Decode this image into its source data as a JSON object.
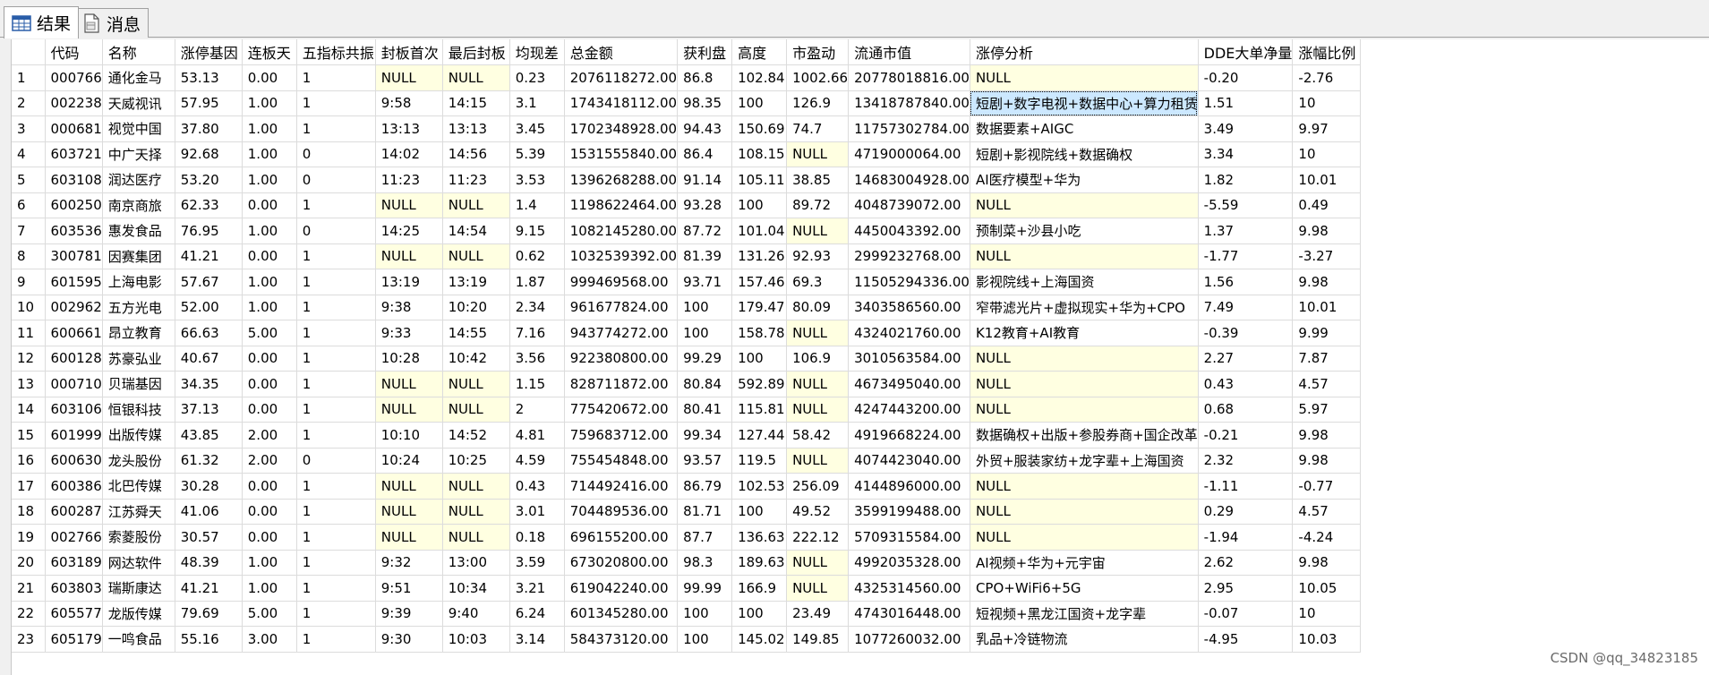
{
  "tabs": [
    {
      "label": "结果",
      "icon": "grid-icon",
      "active": true
    },
    {
      "label": "消息",
      "icon": "message-doc-icon",
      "active": false
    }
  ],
  "grid": {
    "columns": [
      "",
      "代码",
      "名称",
      "涨停基因",
      "连板天",
      "五指标共振",
      "封板首次",
      "最后封板",
      "均现差",
      "总金额",
      "获利盘",
      "高度",
      "市盈动",
      "流通市值",
      "涨停分析",
      "DDE大单净量",
      "涨幅比例"
    ],
    "rows": [
      [
        "1",
        "000766",
        "通化金马",
        "53.13",
        "0.00",
        "1",
        "NULL",
        "NULL",
        "0.23",
        "2076118272.00",
        "86.8",
        "102.84",
        "1002.66",
        "20778018816.00",
        "NULL",
        "-0.20",
        "-2.76"
      ],
      [
        "2",
        "002238",
        "天威视讯",
        "57.95",
        "1.00",
        "1",
        "9:58",
        "14:15",
        "3.1",
        "1743418112.00",
        "98.35",
        "100",
        "126.9",
        "13418787840.00",
        "短剧+数字电视+数据中心+算力租赁",
        "1.51",
        "10"
      ],
      [
        "3",
        "000681",
        "视觉中国",
        "37.80",
        "1.00",
        "1",
        "13:13",
        "13:13",
        "3.45",
        "1702348928.00",
        "94.43",
        "150.69",
        "74.7",
        "11757302784.00",
        "数据要素+AIGC",
        "3.49",
        "9.97"
      ],
      [
        "4",
        "603721",
        "中广天择",
        "92.68",
        "1.00",
        "0",
        "14:02",
        "14:56",
        "5.39",
        "1531555840.00",
        "86.4",
        "108.15",
        "NULL",
        "4719000064.00",
        "短剧+影视院线+数据确权",
        "3.34",
        "10"
      ],
      [
        "5",
        "603108",
        "润达医疗",
        "53.20",
        "1.00",
        "0",
        "11:23",
        "11:23",
        "3.53",
        "1396268288.00",
        "91.14",
        "105.11",
        "38.85",
        "14683004928.00",
        "AI医疗模型+华为",
        "1.82",
        "10.01"
      ],
      [
        "6",
        "600250",
        "南京商旅",
        "62.33",
        "0.00",
        "1",
        "NULL",
        "NULL",
        "1.4",
        "1198622464.00",
        "93.28",
        "100",
        "89.72",
        "4048739072.00",
        "NULL",
        "-5.59",
        "0.49"
      ],
      [
        "7",
        "603536",
        "惠发食品",
        "76.95",
        "1.00",
        "0",
        "14:25",
        "14:54",
        "9.15",
        "1082145280.00",
        "87.72",
        "101.04",
        "NULL",
        "4450043392.00",
        "预制菜+沙县小吃",
        "1.37",
        "9.98"
      ],
      [
        "8",
        "300781",
        "因赛集团",
        "41.21",
        "0.00",
        "1",
        "NULL",
        "NULL",
        "0.62",
        "1032539392.00",
        "81.39",
        "131.26",
        "92.93",
        "2999232768.00",
        "NULL",
        "-1.77",
        "-3.27"
      ],
      [
        "9",
        "601595",
        "上海电影",
        "57.67",
        "1.00",
        "1",
        "13:19",
        "13:19",
        "1.87",
        "999469568.00",
        "93.71",
        "157.46",
        "69.3",
        "11505294336.00",
        "影视院线+上海国资",
        "1.56",
        "9.98"
      ],
      [
        "10",
        "002962",
        "五方光电",
        "52.00",
        "1.00",
        "1",
        "9:38",
        "10:20",
        "2.34",
        "961677824.00",
        "100",
        "179.47",
        "80.09",
        "3403586560.00",
        "窄带滤光片+虚拟现实+华为+CPO",
        "7.49",
        "10.01"
      ],
      [
        "11",
        "600661",
        "昂立教育",
        "66.63",
        "5.00",
        "1",
        "9:33",
        "14:55",
        "7.16",
        "943774272.00",
        "100",
        "158.78",
        "NULL",
        "4324021760.00",
        "K12教育+AI教育",
        "-0.39",
        "9.99"
      ],
      [
        "12",
        "600128",
        "苏豪弘业",
        "40.67",
        "0.00",
        "1",
        "10:28",
        "10:42",
        "3.56",
        "922380800.00",
        "99.29",
        "100",
        "106.9",
        "3010563584.00",
        "NULL",
        "2.27",
        "7.87"
      ],
      [
        "13",
        "000710",
        "贝瑞基因",
        "34.35",
        "0.00",
        "1",
        "NULL",
        "NULL",
        "1.15",
        "828711872.00",
        "80.84",
        "592.89",
        "NULL",
        "4673495040.00",
        "NULL",
        "0.43",
        "4.57"
      ],
      [
        "14",
        "603106",
        "恒银科技",
        "37.13",
        "0.00",
        "1",
        "NULL",
        "NULL",
        "2",
        "775420672.00",
        "80.41",
        "115.81",
        "NULL",
        "4247443200.00",
        "NULL",
        "0.68",
        "5.97"
      ],
      [
        "15",
        "601999",
        "出版传媒",
        "43.85",
        "2.00",
        "1",
        "10:10",
        "14:52",
        "4.81",
        "759683712.00",
        "99.34",
        "127.44",
        "58.42",
        "4919668224.00",
        "数据确权+出版+参股券商+国企改革",
        "-0.21",
        "9.98"
      ],
      [
        "16",
        "600630",
        "龙头股份",
        "61.32",
        "2.00",
        "0",
        "10:24",
        "10:25",
        "4.59",
        "755454848.00",
        "93.57",
        "119.5",
        "NULL",
        "4074423040.00",
        "外贸+服装家纺+龙字辈+上海国资",
        "2.32",
        "9.98"
      ],
      [
        "17",
        "600386",
        "北巴传媒",
        "30.28",
        "0.00",
        "1",
        "NULL",
        "NULL",
        "0.43",
        "714492416.00",
        "86.79",
        "102.53",
        "256.09",
        "4144896000.00",
        "NULL",
        "-1.11",
        "-0.77"
      ],
      [
        "18",
        "600287",
        "江苏舜天",
        "41.06",
        "0.00",
        "1",
        "NULL",
        "NULL",
        "3.01",
        "704489536.00",
        "81.71",
        "100",
        "49.52",
        "3599199488.00",
        "NULL",
        "0.29",
        "4.57"
      ],
      [
        "19",
        "002766",
        "索菱股份",
        "30.57",
        "0.00",
        "1",
        "NULL",
        "NULL",
        "0.18",
        "696155200.00",
        "87.7",
        "136.63",
        "222.12",
        "5709315584.00",
        "NULL",
        "-1.94",
        "-4.24"
      ],
      [
        "20",
        "603189",
        "网达软件",
        "48.39",
        "1.00",
        "1",
        "9:32",
        "13:00",
        "3.59",
        "673020800.00",
        "98.3",
        "189.63",
        "NULL",
        "4992035328.00",
        "AI视频+华为+元宇宙",
        "2.62",
        "9.98"
      ],
      [
        "21",
        "603803",
        "瑞斯康达",
        "41.21",
        "1.00",
        "1",
        "9:51",
        "10:34",
        "3.21",
        "619042240.00",
        "99.99",
        "166.9",
        "NULL",
        "4325314560.00",
        "CPO+WiFi6+5G",
        "2.95",
        "10.05"
      ],
      [
        "22",
        "605577",
        "龙版传媒",
        "79.69",
        "5.00",
        "1",
        "9:39",
        "9:40",
        "6.24",
        "601345280.00",
        "100",
        "100",
        "23.49",
        "4743016448.00",
        "短视频+黑龙江国资+龙字辈",
        "-0.07",
        "10"
      ],
      [
        "23",
        "605179",
        "一鸣食品",
        "55.16",
        "3.00",
        "1",
        "9:30",
        "10:03",
        "3.14",
        "584373120.00",
        "100",
        "145.02",
        "149.85",
        "1077260032.00",
        "乳品+冷链物流",
        "-4.95",
        "10.03"
      ]
    ],
    "selected_cell": {
      "row": 1,
      "col": 14
    },
    "null_highlight_color": "#ffffe1",
    "selected_color": "#cce8ff"
  },
  "watermark": "CSDN @qq_34823185"
}
